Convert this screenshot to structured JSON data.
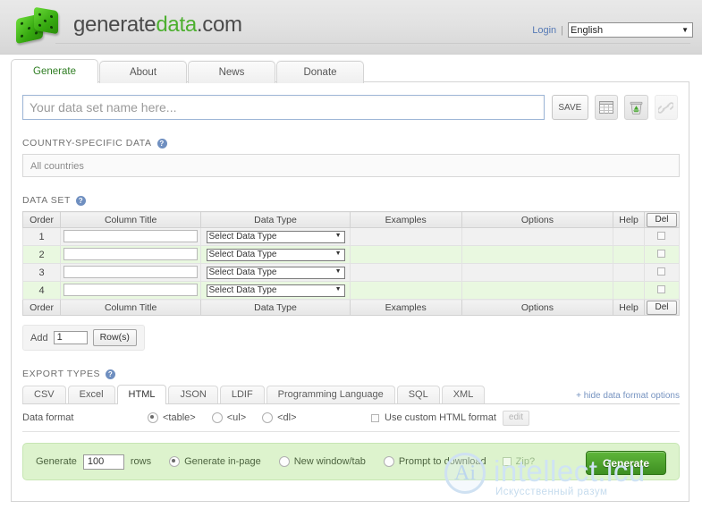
{
  "header": {
    "brand_part1": "generate",
    "brand_part2": "data",
    "brand_part3": ".com",
    "logo_icon": "green-dice-icon",
    "login_label": "Login",
    "separator": "|",
    "language_value": "English",
    "language_caret": "▼"
  },
  "tabs": [
    {
      "label": "Generate",
      "active": true
    },
    {
      "label": "About",
      "active": false
    },
    {
      "label": "News",
      "active": false
    },
    {
      "label": "Donate",
      "active": false
    }
  ],
  "dataset_name": {
    "placeholder": "Your data set name here...",
    "value": "",
    "save_label": "SAVE",
    "icons": [
      "grid-table-icon",
      "recycle-bin-icon",
      "link-chain-icon"
    ]
  },
  "country_section": {
    "heading": "COUNTRY-SPECIFIC DATA",
    "help_glyph": "?",
    "field_value": "All countries"
  },
  "dataset_section": {
    "heading": "DATA SET",
    "help_glyph": "?",
    "columns": [
      "Order",
      "Column Title",
      "Data Type",
      "Examples",
      "Options",
      "Help",
      "Del"
    ],
    "del_button_label": "Del",
    "rows": [
      {
        "order": "1",
        "column_title": "",
        "data_type": "Select Data Type",
        "examples": "",
        "options": "",
        "help": "",
        "stripe": "grey"
      },
      {
        "order": "2",
        "column_title": "",
        "data_type": "Select Data Type",
        "examples": "",
        "options": "",
        "help": "",
        "stripe": "green"
      },
      {
        "order": "3",
        "column_title": "",
        "data_type": "Select Data Type",
        "examples": "",
        "options": "",
        "help": "",
        "stripe": "grey"
      },
      {
        "order": "4",
        "column_title": "",
        "data_type": "Select Data Type",
        "examples": "",
        "options": "",
        "help": "",
        "stripe": "green"
      }
    ],
    "select_caret": "▼",
    "add_prefix": "Add",
    "add_count": "1",
    "add_button_label": "Row(s)"
  },
  "export_section": {
    "heading": "EXPORT TYPES",
    "help_glyph": "?",
    "tabs": [
      {
        "label": "CSV",
        "active": false
      },
      {
        "label": "Excel",
        "active": false
      },
      {
        "label": "HTML",
        "active": true
      },
      {
        "label": "JSON",
        "active": false
      },
      {
        "label": "LDIF",
        "active": false
      },
      {
        "label": "Programming Language",
        "active": false
      },
      {
        "label": "SQL",
        "active": false
      },
      {
        "label": "XML",
        "active": false
      }
    ],
    "hide_options_link": "+ hide data format options",
    "data_format_label": "Data format",
    "format_options": [
      {
        "label": "<table>",
        "selected": true
      },
      {
        "label": "<ul>",
        "selected": false
      },
      {
        "label": "<dl>",
        "selected": false
      }
    ],
    "custom_format_label": "Use custom HTML format",
    "custom_format_checked": false,
    "edit_button_label": "edit"
  },
  "generate_bar": {
    "prefix": "Generate",
    "rows_value": "100",
    "rows_suffix": "rows",
    "options": [
      {
        "label": "Generate in-page",
        "selected": true,
        "dim": false
      },
      {
        "label": "New window/tab",
        "selected": false,
        "dim": false
      },
      {
        "label": "Prompt to download",
        "selected": false,
        "dim": false
      }
    ],
    "zip_label": "Zip?",
    "zip_checked": false,
    "generate_button_label": "Generate"
  },
  "watermark": {
    "logo_text": "Ai",
    "title": "intellect.icu",
    "subtitle": "Искусственный разум"
  },
  "colors": {
    "brand_green": "#4caf2f",
    "row_green": "#e9f8e0",
    "row_grey": "#f1f1f1",
    "generate_green": "#3e8f21",
    "link_blue": "#5579b5"
  }
}
